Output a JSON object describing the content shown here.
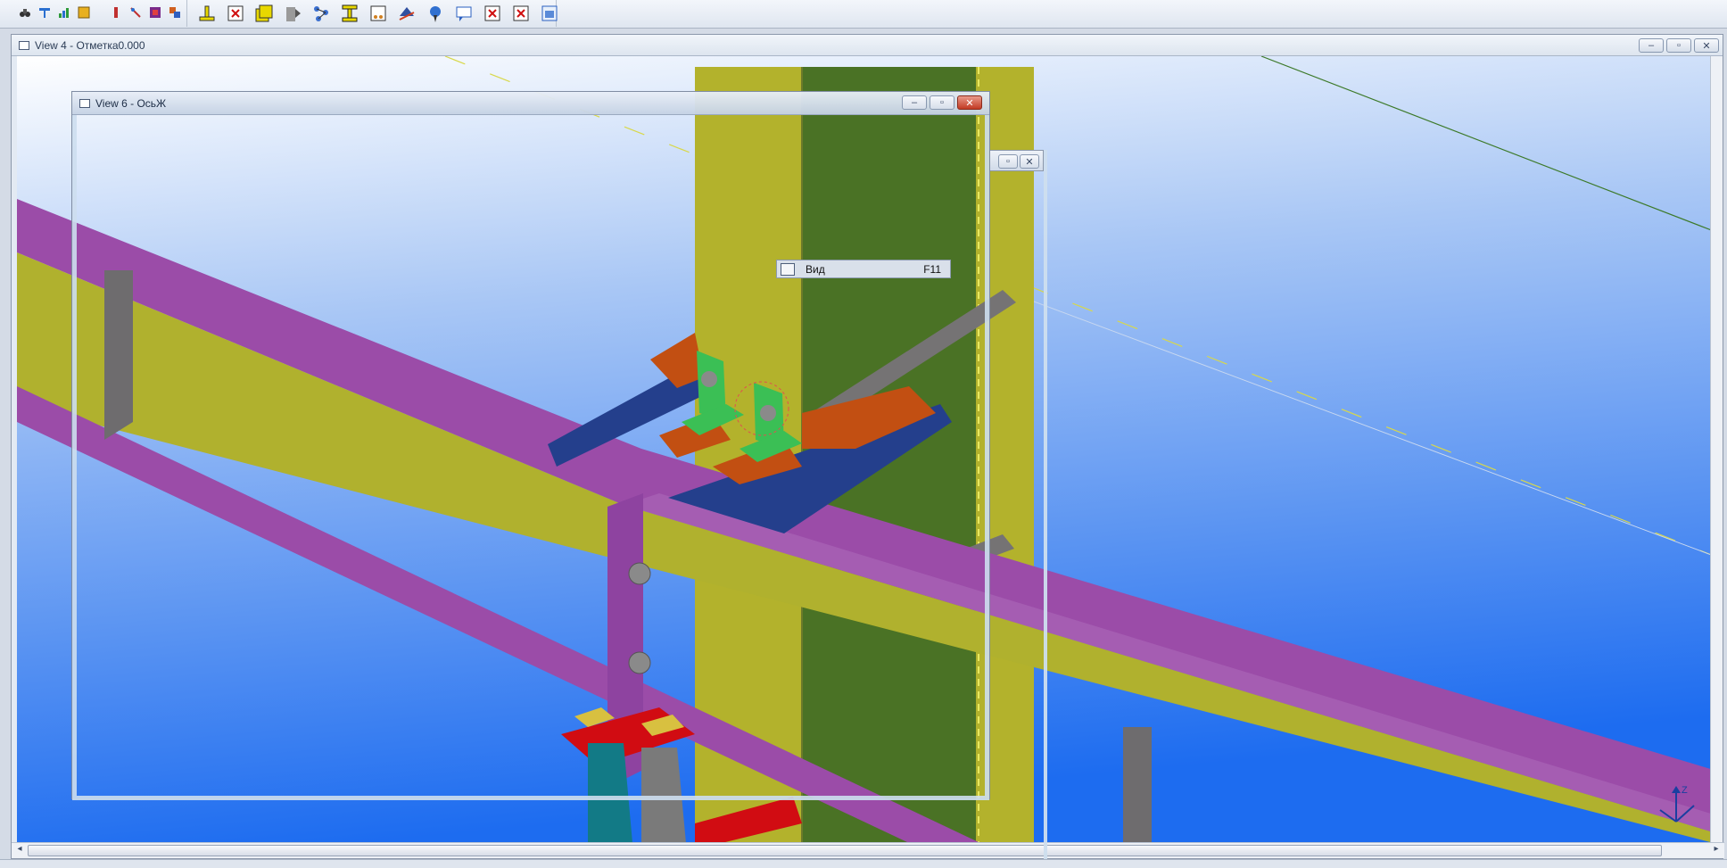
{
  "toolbar": {
    "left_icons": [
      "binoculars-icon",
      "beam-tool-icon",
      "chart-tool-icon",
      "component-icon",
      "column-icon",
      "pin-tool-icon",
      "render-icon",
      "settings-icon"
    ],
    "right_icons": [
      "plate-icon",
      "delete-icon",
      "weld-icon",
      "bolt-icon",
      "network-icon",
      "i-beam-icon",
      "drop-icon",
      "layers-icon",
      "pick-icon",
      "comment-icon",
      "delete-icon",
      "delete-icon",
      "view-icon"
    ]
  },
  "view4": {
    "title": "View 4 - Отметка0.000",
    "colors": {
      "sky_top": "#ffffff",
      "sky_bottom": "#1e6ef0",
      "beam_purple": "#9b4ca8",
      "web_yellow": "#b0b12e",
      "column_green": "#4a7225",
      "plate_blue": "#243f8c",
      "plate_orange": "#c24f12",
      "angle_green": "#3bbf55",
      "gray": "#6e6c6e",
      "red": "#d10c12",
      "teal": "#127a86"
    }
  },
  "view6": {
    "title": "View 6 - ОсьЖ"
  },
  "context_menu": {
    "label": "Вид",
    "shortcut": "F11"
  },
  "axis": {
    "z_label": "Z"
  }
}
